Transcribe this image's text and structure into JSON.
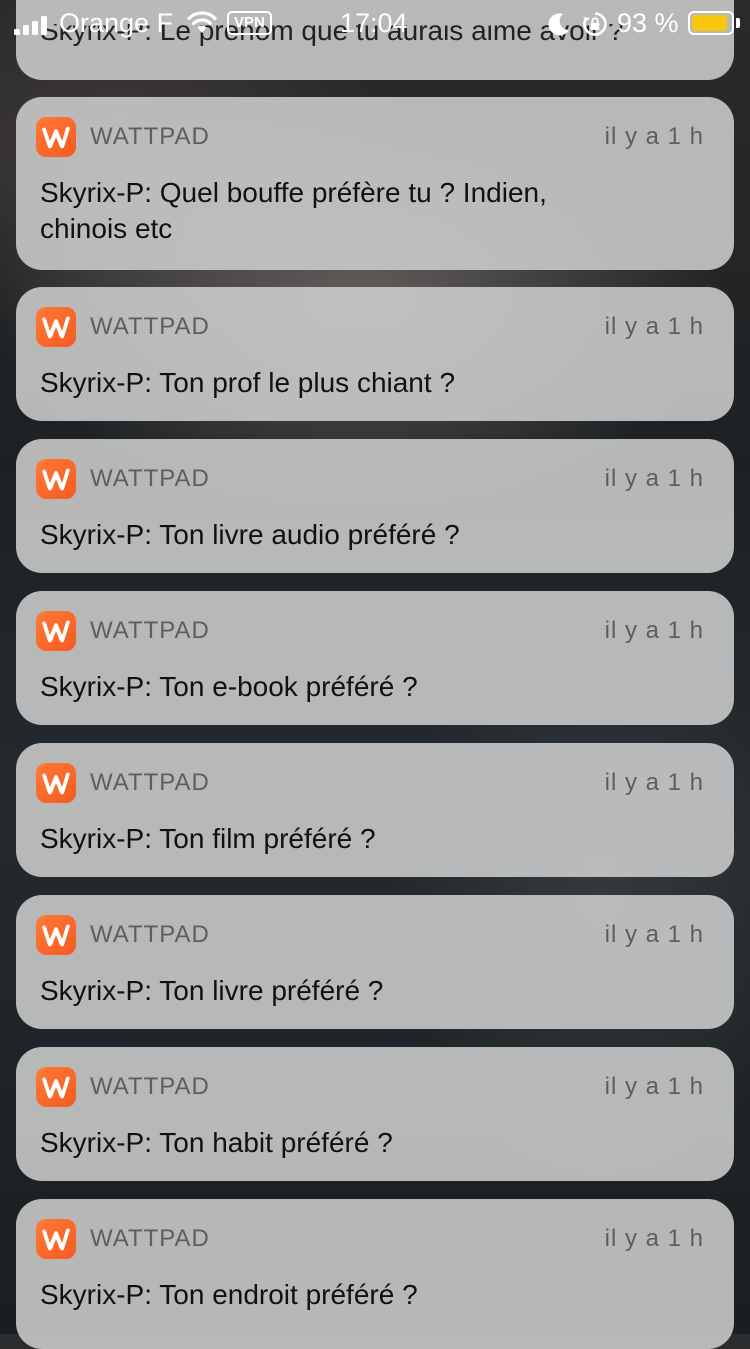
{
  "status": {
    "carrier": "Orange F",
    "vpn": "VPN",
    "time": "17:04",
    "battery_percent": "93 %",
    "battery_level": 0.93,
    "signal_bars": 4,
    "battery_color": "#f7c60d"
  },
  "partial_notification": {
    "message": "Skyrix-P: Le prénom que tu aurais aimé avoir ?"
  },
  "notifications": [
    {
      "app": "WATTPAD",
      "time": "il y a 1 h",
      "message": "Skyrix-P: Quel bouffe préfère tu ? Indien, chinois etc"
    },
    {
      "app": "WATTPAD",
      "time": "il y a 1 h",
      "message": "Skyrix-P: Ton prof le plus chiant ?"
    },
    {
      "app": "WATTPAD",
      "time": "il y a 1 h",
      "message": "Skyrix-P: Ton livre audio préféré ?"
    },
    {
      "app": "WATTPAD",
      "time": "il y a 1 h",
      "message": "Skyrix-P: Ton e-book préféré ?"
    },
    {
      "app": "WATTPAD",
      "time": "il y a 1 h",
      "message": "Skyrix-P: Ton film préféré ?"
    },
    {
      "app": "WATTPAD",
      "time": "il y a 1 h",
      "message": "Skyrix-P: Ton livre préféré ?"
    },
    {
      "app": "WATTPAD",
      "time": "il y a 1 h",
      "message": "Skyrix-P: Ton habit préféré ?"
    },
    {
      "app": "WATTPAD",
      "time": "il y a 1 h",
      "message": "Skyrix-P: Ton endroit préféré ?"
    }
  ],
  "icons": {
    "app_icon": "wattpad-icon",
    "wifi": "wifi-icon",
    "moon": "do-not-disturb-icon",
    "rotation_lock": "rotation-lock-icon",
    "battery": "battery-icon",
    "signal": "signal-icon"
  }
}
